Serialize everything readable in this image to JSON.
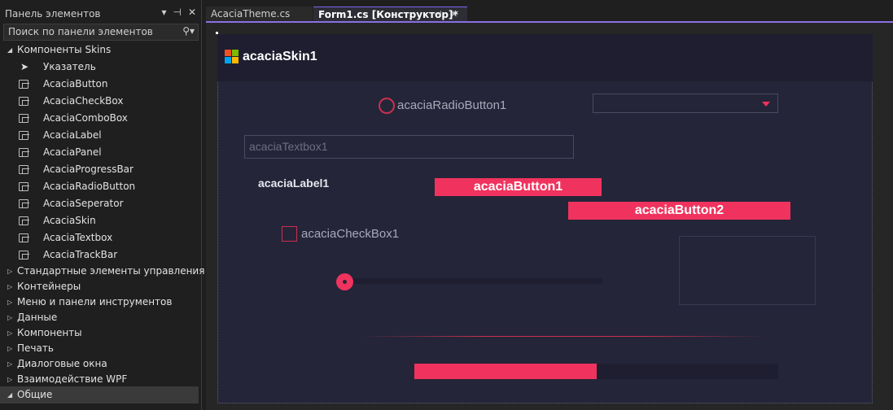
{
  "toolbox": {
    "title": "Панель элементов",
    "search_placeholder": "Поиск по панели элементов",
    "skins_category": "Компоненты Skins",
    "items": [
      {
        "label": "Указатель"
      },
      {
        "label": "AcaciaButton"
      },
      {
        "label": "AcaciaCheckBox"
      },
      {
        "label": "AcaciaComboBox"
      },
      {
        "label": "AcaciaLabel"
      },
      {
        "label": "AcaciaPanel"
      },
      {
        "label": "AcaciaProgressBar"
      },
      {
        "label": "AcaciaRadioButton"
      },
      {
        "label": "AcaciaSeperator"
      },
      {
        "label": "AcaciaSkin"
      },
      {
        "label": "AcaciaTextbox"
      },
      {
        "label": "AcaciaTrackBar"
      }
    ],
    "categories": [
      {
        "label": "Стандартные элементы управления"
      },
      {
        "label": "Контейнеры"
      },
      {
        "label": "Меню и панели инструментов"
      },
      {
        "label": "Данные"
      },
      {
        "label": "Компоненты"
      },
      {
        "label": "Печать"
      },
      {
        "label": "Диалоговые окна"
      },
      {
        "label": "Взаимодействие WPF"
      },
      {
        "label": "Общие"
      }
    ]
  },
  "tabs": {
    "theme": "AcaciaTheme.cs",
    "form": "Form1.cs [Конструктор]*"
  },
  "designer": {
    "skin_title": "acaciaSkin1",
    "radio_label": "acaciaRadioButton1",
    "combo_value": "",
    "textbox_text": "acaciaTextbox1",
    "label_text": "acaciaLabel1",
    "button1_label": "acaciaButton1",
    "button2_label": "acaciaButton2",
    "checkbox_label": "acaciaCheckBox1",
    "trackbar_value": 0,
    "progress_value": 50
  },
  "colors": {
    "accent": "#f0335e",
    "form_bg": "#252539",
    "tab_accent": "#8a6fe6"
  },
  "icons": {
    "toolbox_item": "component-icon",
    "pointer": "pointer-icon",
    "search": "search-icon",
    "skin": "windows-form-icon"
  }
}
